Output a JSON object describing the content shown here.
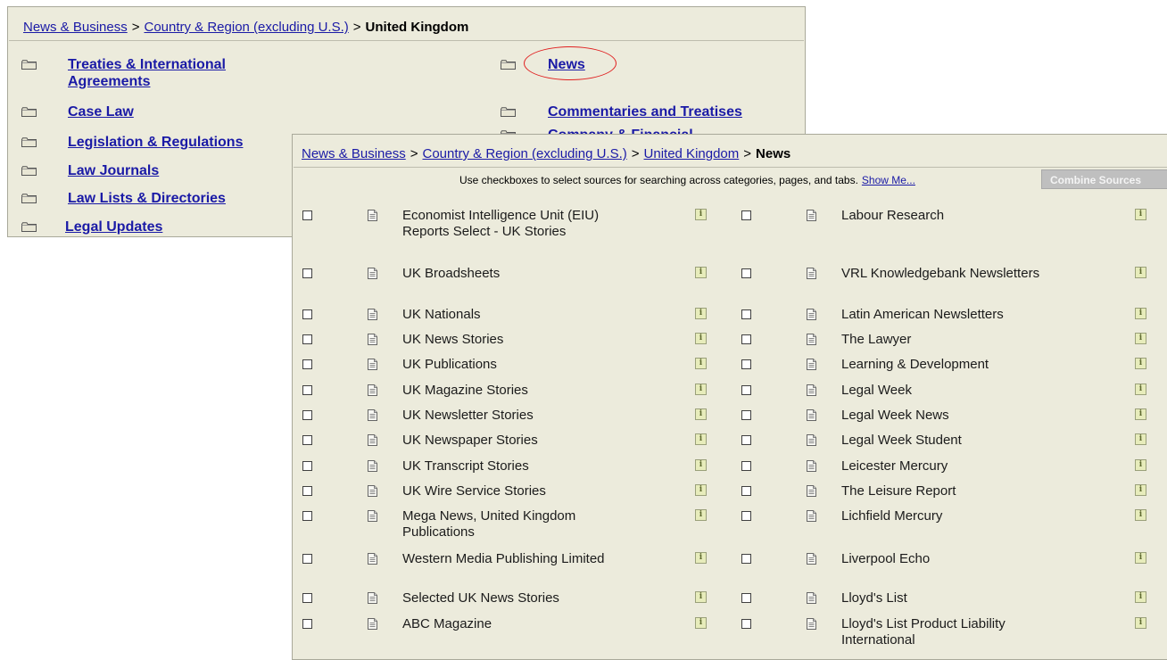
{
  "back": {
    "breadcrumb": [
      {
        "label": "News & Business",
        "link": true
      },
      {
        "label": "Country & Region (excluding U.S.)",
        "link": true
      },
      {
        "label": "United Kingdom",
        "link": false
      }
    ],
    "separator": ">",
    "categories_left": [
      "Treaties & International Agreements",
      "Case Law",
      "Legislation & Regulations",
      "Law Journals",
      "Law Lists & Directories",
      "Legal Updates"
    ],
    "categories_right": [
      "News",
      "Commentaries and Treatises",
      "Company & Financial"
    ]
  },
  "front": {
    "breadcrumb": [
      {
        "label": "News & Business",
        "link": true
      },
      {
        "label": "Country & Region (excluding U.S.)",
        "link": true
      },
      {
        "label": "United Kingdom",
        "link": true
      },
      {
        "label": "News",
        "link": false
      }
    ],
    "separator": ">",
    "hint_text": "Use checkboxes to select sources for searching across categories, pages, and tabs.",
    "show_me_label": "Show Me...",
    "combine_button_label": "Combine Sources",
    "info_glyph": "i",
    "sources_left": [
      "Economist Intelligence Unit (EIU) Reports Select - UK Stories",
      "UK Broadsheets",
      "UK Nationals",
      "UK News Stories",
      "UK Publications",
      "UK Magazine Stories",
      "UK Newsletter Stories",
      "UK Newspaper Stories",
      "UK Transcript Stories",
      "UK Wire Service Stories",
      "Mega News, United Kingdom Publications",
      "Western Media Publishing Limited",
      "Selected UK News Stories",
      "ABC Magazine"
    ],
    "sources_right": [
      "Labour Research",
      "VRL Knowledgebank Newsletters",
      "Latin American Newsletters",
      "The Lawyer",
      "Learning & Development",
      "Legal Week",
      "Legal Week News",
      "Legal Week Student",
      "Leicester Mercury",
      "The Leisure Report",
      "Lichfield Mercury",
      "Liverpool Echo",
      "Lloyd's List",
      "Lloyd's List Product Liability International"
    ]
  },
  "colors": {
    "panel_bg": "#ecebdc",
    "link": "#1a1aa6",
    "highlight_circle": "#e02020"
  },
  "icons": {
    "category": "folder-icon",
    "source": "document-icon",
    "source_info": "info-icon"
  }
}
